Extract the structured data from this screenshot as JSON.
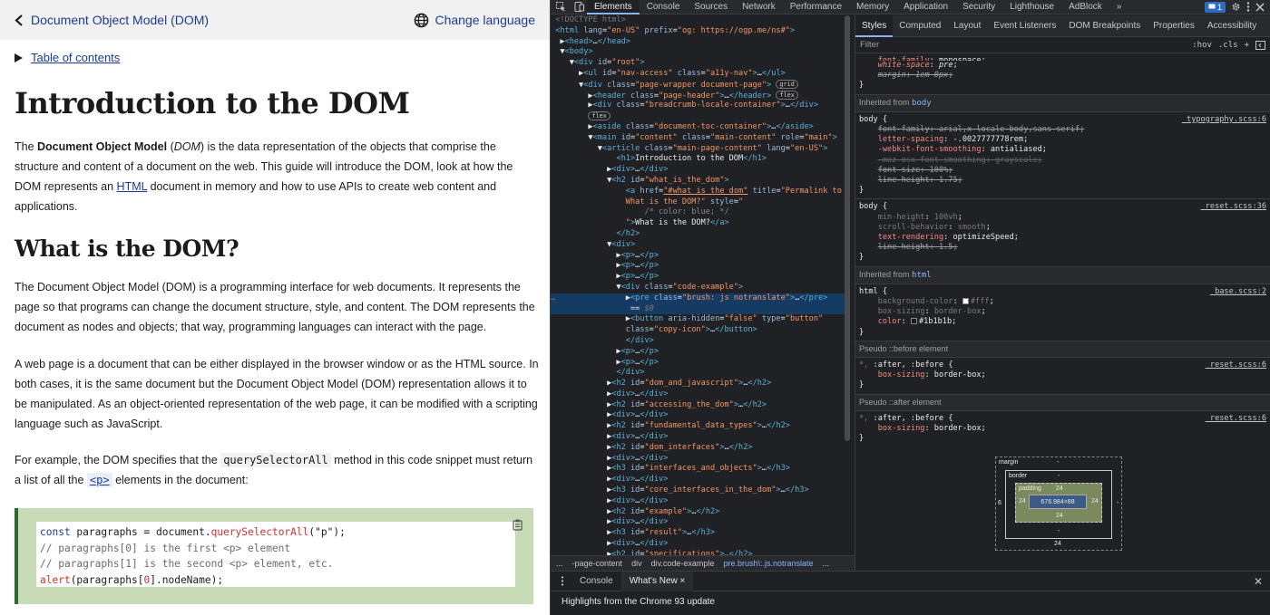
{
  "page": {
    "back_label": "Document Object Model (DOM)",
    "lang_label": "Change language",
    "toc_label": "Table of contents",
    "title": "Introduction to the DOM",
    "p1": {
      "a": "The ",
      "b": "Document Object Model",
      "c": " (",
      "d": "DOM",
      "e": ") is the data representation of the objects that comprise the structure and content of a document on the web. This guide will introduce the DOM, look at how the DOM represents an ",
      "f": "HTML",
      "g": " document in memory and how to use APIs to create web content and applications."
    },
    "subtitle": "What is the DOM?",
    "p2": "The Document Object Model (DOM) is a programming interface for web documents. It represents the page so that programs can change the document structure, style, and content. The DOM represents the document as nodes and objects; that way, programming languages can interact with the page.",
    "p3": "A web page is a document that can be either displayed in the browser window or as the HTML source. In both cases, it is the same document but the Document Object Model (DOM) representation allows it to be manipulated. As an object-oriented representation of the web page, it can be modified with a scripting language such as JavaScript.",
    "p4": {
      "a": "For example, the DOM specifies that the ",
      "b": "querySelectorAll",
      "c": " method in this code snippet must return a list of all the ",
      "d": "<p>",
      "e": " elements in the document:"
    },
    "code": {
      "l1a": "const",
      "l1b": " paragraphs = document.",
      "l1c": "querySelectorAll",
      "l1d": "(\"p\");",
      "l2": "// paragraphs[0] is the first <p> element",
      "l3": "// paragraphs[1] is the second <p> element, etc.",
      "l4a": "alert",
      "l4b": "(paragraphs[",
      "l4c": "0",
      "l4d": "].nodeName);"
    }
  },
  "devtools": {
    "tabs": [
      "Elements",
      "Console",
      "Sources",
      "Network",
      "Performance",
      "Memory",
      "Application",
      "Security",
      "Lighthouse",
      "AdBlock"
    ],
    "more": "»",
    "issues_count": "1",
    "styles_tabs": [
      "Styles",
      "Computed",
      "Layout",
      "Event Listeners",
      "DOM Breakpoints",
      "Properties",
      "Accessibility"
    ],
    "filter_placeholder": "Filter",
    "hov": ":hov",
    "cls": ".cls",
    "breadcrumbs": [
      "...",
      "-page-content",
      "div",
      "div.code-example",
      "pre.brush\\:.js.notranslate",
      "..."
    ],
    "drawer_tabs": [
      "Console",
      "What's New"
    ],
    "drawer_msg": "Highlights from the Chrome 93 update",
    "boxmodel": {
      "margin_label": "margin",
      "margin_val": "-",
      "border_label": "border",
      "border_val": "-",
      "padding_label": "padding",
      "padding_top": "24",
      "padding_right": "24",
      "padding_bottom": "24",
      "padding_left": "24",
      "content": "676.984×88",
      "left_margin": "6",
      "right_margin": "-",
      "bottom_margin": "24",
      "bottom_dash": "-"
    }
  }
}
